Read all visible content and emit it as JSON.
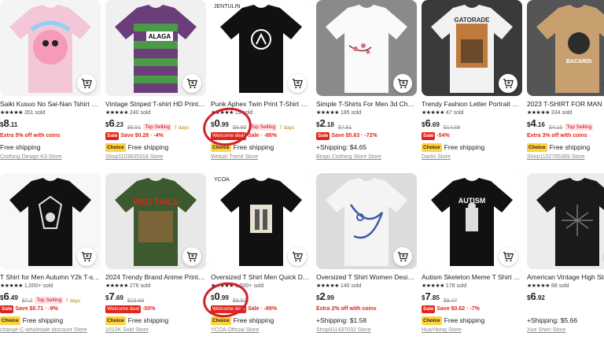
{
  "cart_icon": "add-to-cart-icon",
  "products": [
    {
      "title": "Saiki Kusuo No Sai-Nan Tshirt Prin...",
      "rating": "351 sold",
      "price_main": "8",
      "price_cents": ".11",
      "old_price": "",
      "top_selling": "",
      "days": "",
      "promo": "Extra 5% off with coins",
      "promo_type": "coins",
      "shipping": "Free shipping",
      "choice": false,
      "store": "Clothing Design K3 Store"
    },
    {
      "title": "Vintage Striped T-shirt HD Print C...",
      "rating": "240 sold",
      "price_main": "6",
      "price_cents": ".23",
      "old_price": "$6.51",
      "top_selling": "Top Selling",
      "days": "7 days",
      "promo": "Save $0.28 · -4%",
      "promo_type": "sale",
      "shipping": "Free shipping",
      "choice": true,
      "store": "Shop1103835318 Store"
    },
    {
      "title": "Punk Aphex Twin Print T-Shirt Ove...",
      "rating": "19 sold",
      "price_main": "0",
      "price_cents": ".99",
      "old_price": "$8.95",
      "top_selling": "Top Selling",
      "days": "7 days",
      "promo": "Welcome deal",
      "promo_extra": "Sale · -88%",
      "promo_type": "welcome",
      "shipping": "Free shipping",
      "choice": true,
      "store": "Writuln Trend Store"
    },
    {
      "title": "Simple T-Shirts For Men 3d Cherry-...",
      "rating": "185 sold",
      "price_main": "2",
      "price_cents": ".18",
      "old_price": "$7.81",
      "top_selling": "",
      "days": "",
      "promo": "Save $5.63 · -72%",
      "promo_type": "sale",
      "shipping": "+Shipping: $4.65",
      "choice": false,
      "store": "Bingo Clothing Store Store"
    },
    {
      "title": "Trendy Fashion Letter Portrait Pri...",
      "rating": "47 sold",
      "price_main": "6",
      "price_cents": ".69",
      "old_price": "$14.69",
      "top_selling": "",
      "days": "",
      "promo": "-54%",
      "promo_type": "sale",
      "shipping": "Free shipping",
      "choice": true,
      "store": "Darlin Store"
    },
    {
      "title": "2023 T-SHIRT FOR MAN Fash...",
      "rating": "334 sold",
      "price_main": "4",
      "price_cents": ".16",
      "old_price": "$4.16",
      "top_selling": "Top Selling",
      "days": "",
      "promo": "Extra 3% off with coins",
      "promo_type": "coins",
      "shipping": "Free shipping",
      "choice": true,
      "store": "Shop1102765389 Store"
    },
    {
      "title": "T Shirt for Men Autumn Y2k T-shir...",
      "rating": "1,000+ sold",
      "price_main": "6",
      "price_cents": ".49",
      "old_price": "$7.2",
      "top_selling": "Top Selling",
      "days": "7 days",
      "promo": "Save $0.71 · -9%",
      "promo_type": "sale",
      "shipping": "Free shipping",
      "choice": true,
      "store": "change-C-wholesale discount Store"
    },
    {
      "title": "2024 Trendy Brand Anime Printed...",
      "rating": "276 sold",
      "price_main": "7",
      "price_cents": ".69",
      "old_price": "$15.69",
      "top_selling": "",
      "days": "",
      "promo": "Welcome deal",
      "promo_extra": "-50%",
      "promo_type": "welcome",
      "shipping": "Free shipping",
      "choice": true,
      "store": "1010K Sold Store"
    },
    {
      "title": "Oversized T Shirt Men Quick Dryin...",
      "rating": "1,000+ sold",
      "price_main": "0",
      "price_cents": ".99",
      "old_price": "$9.52",
      "top_selling": "",
      "days": "",
      "promo": "Welcome deal",
      "promo_extra": "Sale · -89%",
      "promo_type": "welcome",
      "shipping": "Free shipping",
      "choice": true,
      "store": "YCOA Official Store"
    },
    {
      "title": "Oversized T Shirt Women Design S...",
      "rating": "140 sold",
      "price_main": "2",
      "price_cents": ".99",
      "old_price": "",
      "top_selling": "",
      "days": "",
      "promo": "Extra 2% off with coins",
      "promo_type": "coins",
      "shipping": "+Shipping: $1.58",
      "choice": false,
      "store": "Shop911437032 Store"
    },
    {
      "title": "Autism Skeleton Meme T Shirt Hu...",
      "rating": "178 sold",
      "price_main": "7",
      "price_cents": ".85",
      "old_price": "$8.47",
      "top_selling": "",
      "days": "",
      "promo": "Save $0.62 · -7%",
      "promo_type": "sale",
      "shipping": "Free shipping",
      "choice": true,
      "store": "HuaYibing Store"
    },
    {
      "title": "American Vintage High Stree...",
      "rating": "88 sold",
      "price_main": "6",
      "price_cents": ".92",
      "old_price": "",
      "top_selling": "",
      "days": "",
      "promo": "",
      "promo_type": "none",
      "shipping": "+Shipping: $5.66",
      "choice": false,
      "store": "Xue Shen Store"
    }
  ],
  "labels": {
    "sale": "Sale",
    "choice": "Choice",
    "stars": "★★★★★",
    "currency": "$"
  },
  "image_texts": {
    "p1": "ALAGA",
    "p2": "JENTULIN",
    "p4": "GATORADE",
    "p5": "BACARDI",
    "p7": "RED TAILS",
    "p8": "YCOA",
    "p10": "AUTISM"
  }
}
